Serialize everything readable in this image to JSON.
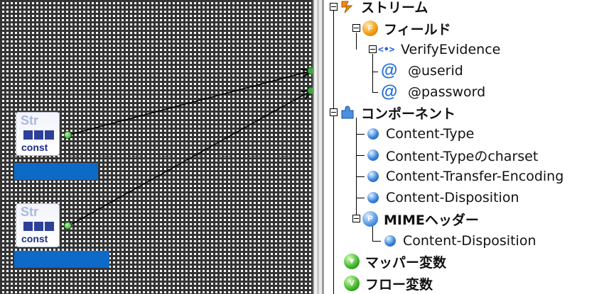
{
  "canvas": {
    "nodes": [
      {
        "top_label": "Str",
        "bottom_label": "const"
      },
      {
        "top_label": "Str",
        "bottom_label": "const"
      }
    ]
  },
  "tree": {
    "stream": {
      "label": "ストリーム",
      "icon": "stream-icon"
    },
    "field": {
      "label": "フィールド",
      "icon": "field-icon",
      "letter": "F"
    },
    "verify": {
      "label": "VerifyEvidence",
      "icon": "element-icon",
      "glyph": "<•>"
    },
    "userid": {
      "label": "@userid",
      "glyph": "@"
    },
    "password": {
      "label": "@password",
      "glyph": "@"
    },
    "components": {
      "label": "コンポーネント",
      "icon": "puzzle-icon"
    },
    "component_items": [
      {
        "label": "Content-Type"
      },
      {
        "label": "Content-Typeのcharset"
      },
      {
        "label": "Content-Transfer-Encoding"
      },
      {
        "label": "Content-Disposition"
      }
    ],
    "mime": {
      "label": "MIMEヘッダー",
      "letter": "P"
    },
    "mime_items": [
      {
        "label": "Content-Disposition"
      }
    ],
    "mapper_vars": {
      "label": "マッパー変数",
      "letter": "▼"
    },
    "flow_vars": {
      "label": "フロー変数",
      "letter": "V"
    }
  }
}
